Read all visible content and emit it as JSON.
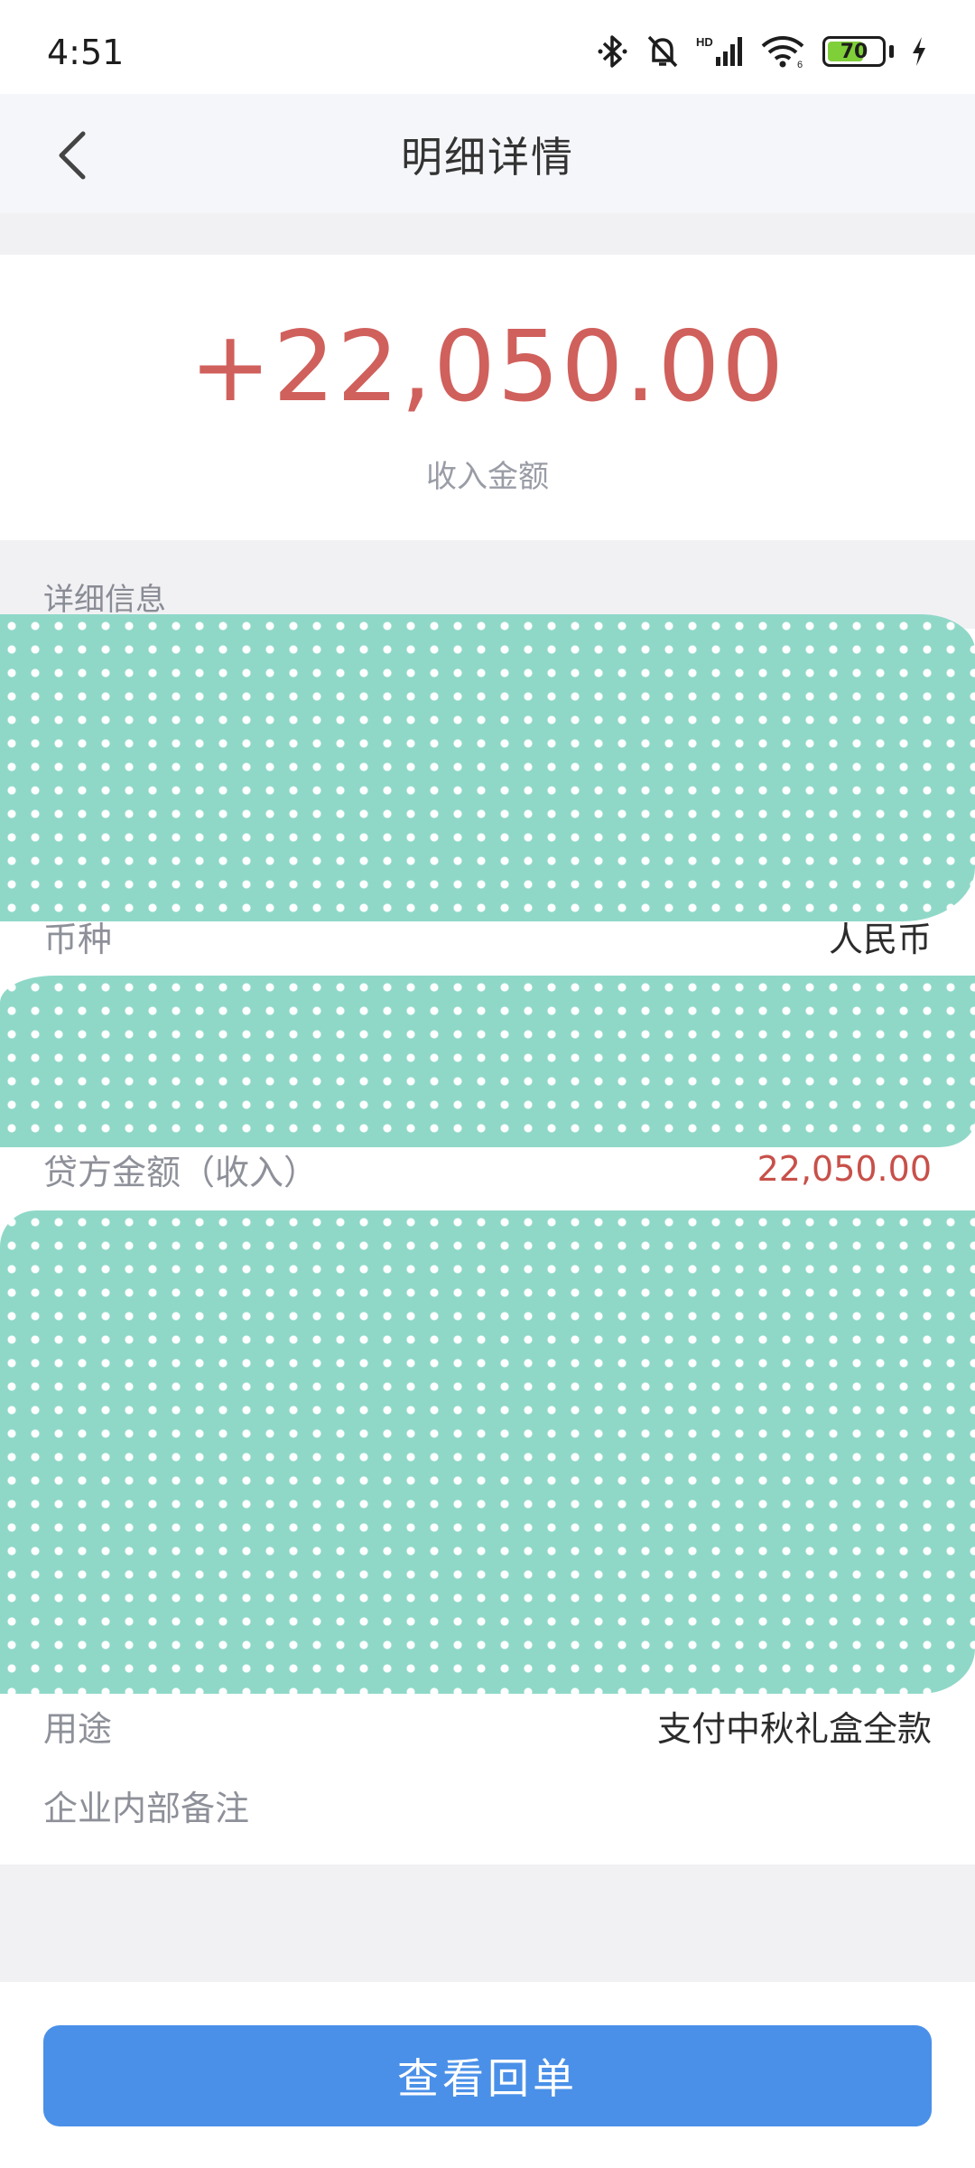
{
  "status_bar": {
    "time": "4:51",
    "battery_level": "70",
    "battery_fraction": 0.7,
    "icons": [
      "bluetooth-icon",
      "bell-off-icon",
      "signal-icon",
      "wifi-icon",
      "battery-icon",
      "charging-icon"
    ]
  },
  "nav": {
    "title": "明细详情",
    "back_icon": "chevron-left-icon"
  },
  "amount": {
    "value": "+22,050.00",
    "label": "收入金额",
    "color": "#d0605c"
  },
  "details": {
    "section_label": "详细信息",
    "rows": [
      {
        "label": "币种",
        "value": "人民币"
      },
      {
        "label": "贷方金额（收入）",
        "value": "22,050.00"
      },
      {
        "label": "用途",
        "value": "支付中秋礼盒全款"
      },
      {
        "label": "企业内部备注",
        "value": ""
      }
    ]
  },
  "footer": {
    "receipt_button": "查看回单",
    "accent": "#4a90e8"
  }
}
